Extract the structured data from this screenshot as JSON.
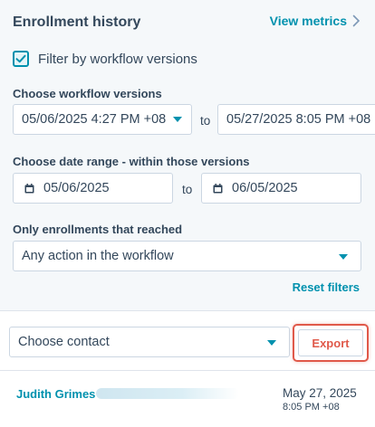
{
  "header": {
    "title": "Enrollment history",
    "view_metrics": "View metrics"
  },
  "filter_versions": {
    "label": "Filter by workflow versions",
    "checked": true
  },
  "versions": {
    "label": "Choose workflow versions",
    "from": "05/06/2025 4:27 PM +08",
    "separator": "to",
    "to": "05/27/2025 8:05 PM +08"
  },
  "date_range": {
    "label": "Choose date range - within those versions",
    "start": "05/06/2025",
    "separator": "to",
    "end": "06/05/2025"
  },
  "enrollment_filter": {
    "label": "Only enrollments that reached",
    "value": "Any action in the workflow"
  },
  "reset_filters": "Reset filters",
  "contact_select": {
    "value": "Choose contact"
  },
  "export_label": "Export",
  "records": [
    {
      "name": "Judith Grimes",
      "date": "May 27, 2025",
      "time": "8:05 PM +08"
    }
  ],
  "colors": {
    "accent": "#0091ae",
    "export": "#e0594a",
    "panel_bg": "#f5f8fa",
    "text": "#33475b"
  }
}
